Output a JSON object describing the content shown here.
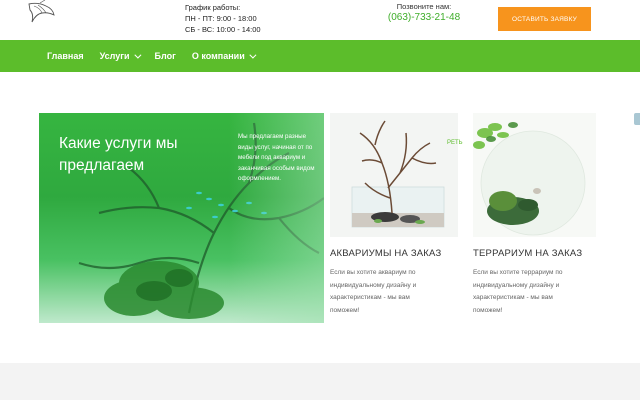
{
  "header": {
    "hours_label": "График работы:",
    "hours_weekdays": "ПН - ПТ: 9:00 - 18:00",
    "hours_weekend": "СБ - ВС: 10:00 - 14:00",
    "call_label": "Позвоните нам:",
    "phone": "(063)-733-21-48",
    "cta_label": "ОСТАВИТЬ ЗАЯВКУ",
    "logo_icon": "angelfish-logo-icon"
  },
  "nav": {
    "items": [
      {
        "label": "Главная"
      },
      {
        "label": "Услуги"
      },
      {
        "label": "Блог"
      },
      {
        "label": "О компании"
      }
    ]
  },
  "hero": {
    "title": "Какие услуги мы предлагаем",
    "text_lines": [
      "Мы предлагаем разные",
      "виды услуг, начиная от по",
      "мебели под аквариум и",
      "заканчивая особым видом",
      "оформлением."
    ]
  },
  "more_link": "РЕТЬ",
  "cards": [
    {
      "title": "АКВАРИУМЫ НА ЗАКАЗ",
      "desc_lines": [
        "Если вы хотите аквариум по",
        "индивидуальному дизайну и",
        "характеристикам - мы вам",
        "поможем!"
      ]
    },
    {
      "title": "ТЕРРАРИУМ НА ЗАКАЗ",
      "desc_lines": [
        "Если вы хотите террариум по",
        "индивидуальному дизайну и",
        "характеристикам - мы вам",
        "поможем!"
      ]
    }
  ],
  "colors": {
    "brand_green": "#5cbd2b",
    "cta_orange": "#f7941d",
    "phone_green": "#3fae2a"
  }
}
